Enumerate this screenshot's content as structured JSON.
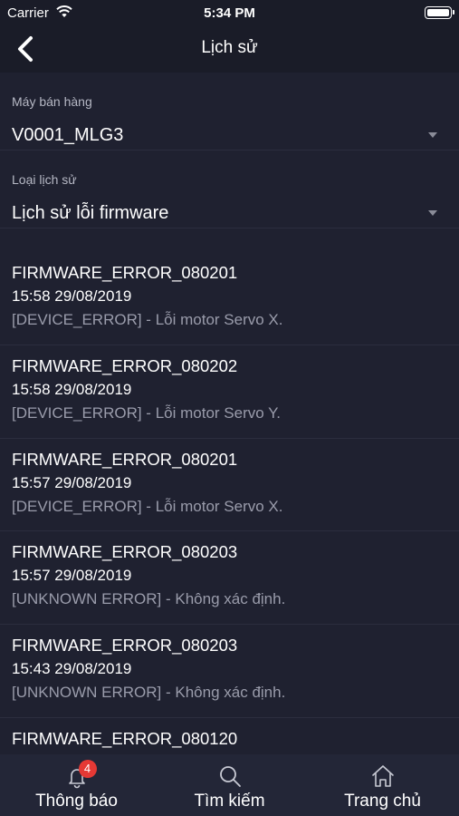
{
  "status_bar": {
    "carrier": "Carrier",
    "time": "5:34 PM"
  },
  "nav": {
    "title": "Lịch sử"
  },
  "filters": {
    "machine": {
      "label": "Máy bán hàng",
      "value": "V0001_MLG3"
    },
    "history_type": {
      "label": "Loại lịch sử",
      "value": "Lịch sử lỗi firmware"
    }
  },
  "history": [
    {
      "code": "FIRMWARE_ERROR_080201",
      "time": "15:58 29/08/2019",
      "desc": "[DEVICE_ERROR] - Lỗi motor Servo X."
    },
    {
      "code": "FIRMWARE_ERROR_080202",
      "time": "15:58 29/08/2019",
      "desc": "[DEVICE_ERROR] - Lỗi motor Servo Y."
    },
    {
      "code": "FIRMWARE_ERROR_080201",
      "time": "15:57 29/08/2019",
      "desc": "[DEVICE_ERROR] - Lỗi motor Servo X."
    },
    {
      "code": "FIRMWARE_ERROR_080203",
      "time": "15:57 29/08/2019",
      "desc": "[UNKNOWN ERROR] - Không xác định."
    },
    {
      "code": "FIRMWARE_ERROR_080203",
      "time": "15:43 29/08/2019",
      "desc": "[UNKNOWN ERROR] - Không xác định."
    },
    {
      "code": "FIRMWARE_ERROR_080120",
      "time": "",
      "desc": ""
    }
  ],
  "tabs": [
    {
      "label": "Thông báo",
      "icon": "bell-icon",
      "badge": "4"
    },
    {
      "label": "Tìm kiếm",
      "icon": "search-icon"
    },
    {
      "label": "Trang chủ",
      "icon": "home-icon"
    }
  ],
  "colors": {
    "background": "#1f2130",
    "bar": "#1a1c28",
    "badge": "#e53935",
    "muted_text": "#9a9cab"
  }
}
